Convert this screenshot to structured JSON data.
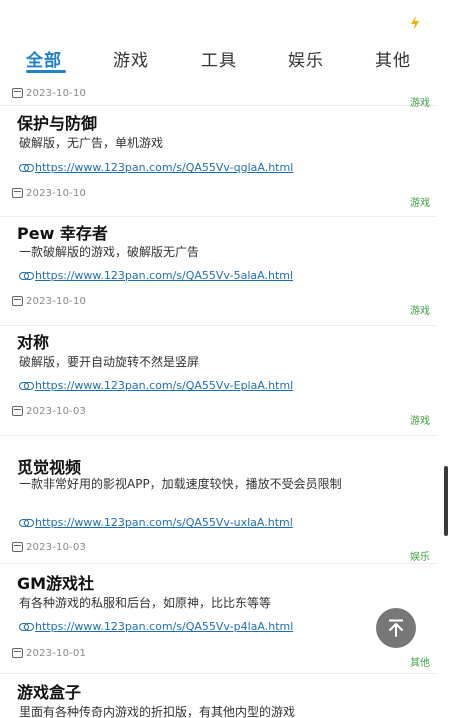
{
  "tabs": [
    {
      "label": "全部",
      "active": true
    },
    {
      "label": "游戏",
      "active": false
    },
    {
      "label": "工具",
      "active": false
    },
    {
      "label": "娱乐",
      "active": false
    },
    {
      "label": "其他",
      "active": false
    }
  ],
  "partial_item": {
    "date": "2023-10-10",
    "category": "游戏"
  },
  "items": [
    {
      "title": "保护与防御",
      "description": "破解版，无广告，单机游戏",
      "link": "https://www.123pan.com/s/QA55Vv-qglaA.html",
      "date": "2023-10-10",
      "category": "游戏"
    },
    {
      "title": "Pew 幸存者",
      "description": "一款破解版的游戏，破解版无广告",
      "link": "https://www.123pan.com/s/QA55Vv-5alaA.html",
      "date": "2023-10-10",
      "category": "游戏"
    },
    {
      "title": "对称",
      "description": "破解版，要开自动旋转不然是竖屏",
      "link": "https://www.123pan.com/s/QA55Vv-EplaA.html",
      "date": "2023-10-03",
      "category": "游戏"
    },
    {
      "title": "觅觉视频",
      "description": "一款非常好用的影视APP，加载速度较快，播放不受会员限制",
      "link": "https://www.123pan.com/s/QA55Vv-uxlaA.html",
      "date": "2023-10-03",
      "category": "娱乐"
    },
    {
      "title": "GM游戏社",
      "description": "有各种游戏的私服和后台，如原神，比比东等等",
      "link": "https://www.123pan.com/s/QA55Vv-p4laA.html",
      "date": "2023-10-01",
      "category": "其他"
    },
    {
      "title": "游戏盒子",
      "description": "里面有各种传奇内游戏的折扣版，有其他内型的游戏"
    }
  ],
  "colors": {
    "accent": "#1f82c8",
    "link": "#1f6fb0",
    "category": "#3aa23f"
  },
  "icons": {
    "top_right": "lightning-icon",
    "date": "calendar-icon",
    "link": "link-icon",
    "fab": "scroll-to-top-icon"
  }
}
